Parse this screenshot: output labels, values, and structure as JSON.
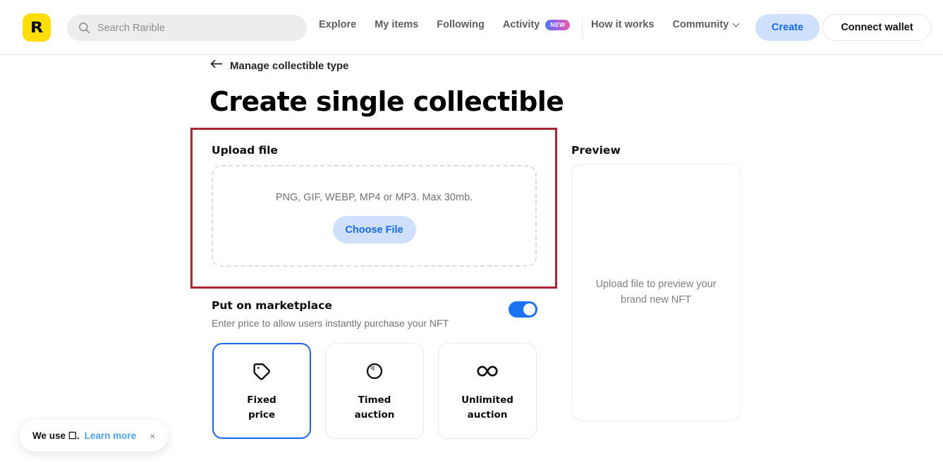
{
  "header": {
    "logo_alt": "R",
    "search": {
      "placeholder": "Search Rarible",
      "value": ""
    },
    "nav": [
      {
        "label": "Explore",
        "badge": null
      },
      {
        "label": "My items",
        "badge": null
      },
      {
        "label": "Following",
        "badge": null
      },
      {
        "label": "Activity",
        "badge": "NEW"
      }
    ],
    "nav_right": [
      {
        "label": "How it works",
        "has_chevron": false
      },
      {
        "label": "Community",
        "has_chevron": true
      }
    ],
    "create_button": "Create",
    "wallet_button": "Connect wallet"
  },
  "page": {
    "back_link": "Manage collectible type",
    "title": "Create single collectible"
  },
  "upload": {
    "section_label": "Upload file",
    "dropzone_hint": "PNG, GIF, WEBP, MP4 or MP3. Max 30mb.",
    "choose_button": "Choose File",
    "highlight_color": "#ab2330"
  },
  "marketplace": {
    "section_label": "Put on marketplace",
    "subtitle": "Enter price to allow users instantly purchase your NFT",
    "toggle_on": true,
    "toggle_color": "#1a73f0",
    "options": [
      {
        "label_line1": "Fixed",
        "label_line2": "price",
        "icon": "price-tag-icon",
        "selected": true
      },
      {
        "label_line1": "Timed",
        "label_line2": "auction",
        "icon": "timer-icon",
        "selected": false
      },
      {
        "label_line1": "Unlimited",
        "label_line2": "auction",
        "icon": "infinity-icon",
        "selected": false
      }
    ]
  },
  "preview": {
    "section_label": "Preview",
    "empty_text": "Upload file to preview your brand new NFT"
  },
  "cookie_banner": {
    "text": "We use ☐.",
    "link": "Learn more",
    "close": "×"
  }
}
